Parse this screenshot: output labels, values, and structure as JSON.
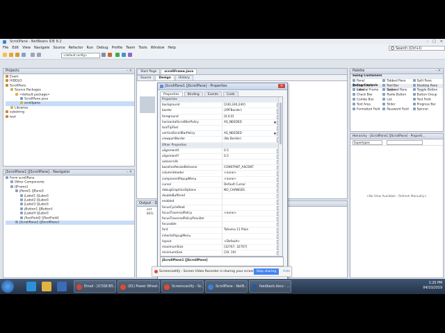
{
  "window": {
    "title": "ScrollPane - NetBeans IDE 8.2"
  },
  "menu": [
    "File",
    "Edit",
    "View",
    "Navigate",
    "Source",
    "Refactor",
    "Run",
    "Debug",
    "Profile",
    "Team",
    "Tools",
    "Window",
    "Help"
  ],
  "search": {
    "placeholder": "Search (Ctrl+I)"
  },
  "toolbar": {
    "config": "<default config>"
  },
  "projects": {
    "header": "Projects",
    "items": [
      {
        "label": "Exam",
        "indent": 0,
        "color": "#c98b2c"
      },
      {
        "label": "HIDDLO",
        "indent": 0,
        "color": "#c98b2c"
      },
      {
        "label": "ScrollPane",
        "indent": 0,
        "color": "#c98b2c"
      },
      {
        "label": "Source Packages",
        "indent": 1,
        "color": "#d8b14a"
      },
      {
        "label": "<default package>",
        "indent": 2,
        "color": "#d8b14a"
      },
      {
        "label": "ScrollPane.java",
        "indent": 3,
        "color": "#6e9bd1"
      },
      {
        "label": "scrollpane",
        "indent": 3,
        "color": "#d8b14a"
      },
      {
        "label": "Libraries",
        "indent": 1,
        "color": "#d8b14a"
      },
      {
        "label": "substring",
        "indent": 0,
        "color": "#c98b2c"
      },
      {
        "label": "test",
        "indent": 0,
        "color": "#c98b2c"
      }
    ]
  },
  "navigator": {
    "header": "jScrollPane1 [JScrollPane] - Navigator",
    "items": [
      {
        "label": "Form scrollPane",
        "indent": 0
      },
      {
        "label": "Other Components",
        "indent": 1
      },
      {
        "label": "[JFrame]",
        "indent": 1
      },
      {
        "label": "jPanel1 [JPanel]",
        "indent": 2
      },
      {
        "label": "jLabel1 [JLabel]",
        "indent": 3
      },
      {
        "label": "jLabel2 [JLabel]",
        "indent": 3
      },
      {
        "label": "jLabel3 [JLabel]",
        "indent": 3
      },
      {
        "label": "jButton1 [JButton]",
        "indent": 3
      },
      {
        "label": "jLabel4 [JLabel]",
        "indent": 3
      },
      {
        "label": "jTextField2 [JTextField]",
        "indent": 3
      },
      {
        "label": "jScrollPane1 [JScrollPane]",
        "indent": 2
      }
    ]
  },
  "editor": {
    "tabs": [
      "Start Page",
      "scrollFrame.java"
    ],
    "subtabs": [
      "Source",
      "Design",
      "History"
    ]
  },
  "output": {
    "header": "Output - Scro",
    "lines": [
      "ant",
      "BUIL"
    ]
  },
  "palette": {
    "header": "Palette",
    "groups": [
      {
        "title": "Swing Containers",
        "items": [
          "Panel",
          "Tabbed Pane",
          "Split Pane",
          "Scroll Pane",
          "Tool Bar",
          "Desktop Pane",
          "Internal Frame",
          "Layered Pane"
        ]
      },
      {
        "title": "Swing Controls",
        "items": [
          "Label",
          "Button",
          "Toggle Button",
          "Check Box",
          "Radio Button",
          "Button Group",
          "Combo Box",
          "List",
          "Text Field",
          "Text Area",
          "Slider",
          "Progress Bar",
          "Formatted Field",
          "Password Field",
          "Spinner"
        ]
      }
    ]
  },
  "hierarchy": {
    "header": "Hierarchy - jScrollPane1 [JScrollPane] - Properti...",
    "scope": "Supertypes",
    "empty": "<No View Available - Refresh Manually>"
  },
  "dialog": {
    "title": "jScrollPane1 [JScrollPane] - Properties",
    "tabs": [
      "Properties",
      "Binding",
      "Events",
      "Code"
    ],
    "rows": [
      {
        "name": "Properties",
        "value": "",
        "cat": true
      },
      {
        "name": "background",
        "value": "[240,240,240]"
      },
      {
        "name": "border",
        "value": "(XPFBorder)"
      },
      {
        "name": "foreground",
        "value": "[0,0,0]"
      },
      {
        "name": "horizontalScrollBarPolicy",
        "value": "AS_NEEDED",
        "dd": true
      },
      {
        "name": "toolTipText",
        "value": ""
      },
      {
        "name": "verticalScrollBarPolicy",
        "value": "AS_NEEDED",
        "dd": true
      },
      {
        "name": "viewportBorder",
        "value": "(No Border)"
      },
      {
        "name": "Other Properties",
        "value": "",
        "cat": true
      },
      {
        "name": "alignmentX",
        "value": "0.5"
      },
      {
        "name": "alignmentY",
        "value": "0.5"
      },
      {
        "name": "autoscrolls",
        "value": ""
      },
      {
        "name": "baselineResizeBehavior",
        "value": "CONSTANT_ASCENT"
      },
      {
        "name": "columnHeader",
        "value": "<none>"
      },
      {
        "name": "componentPopupMenu",
        "value": "<none>"
      },
      {
        "name": "cursor",
        "value": "Default Cursor"
      },
      {
        "name": "debugGraphicsOptions",
        "value": "NO_CHANGES"
      },
      {
        "name": "doubleBuffered",
        "value": ""
      },
      {
        "name": "enabled",
        "value": ""
      },
      {
        "name": "focusCycleRoot",
        "value": ""
      },
      {
        "name": "focusTraversalPolicy",
        "value": "<none>"
      },
      {
        "name": "focusTraversalPolicyProvider",
        "value": ""
      },
      {
        "name": "focusable",
        "value": ""
      },
      {
        "name": "font",
        "value": "Tahoma 11 Plain"
      },
      {
        "name": "inheritsPopupMenu",
        "value": ""
      },
      {
        "name": "layout",
        "value": "<Default>"
      },
      {
        "name": "maximumSize",
        "value": "[32767, 32767]"
      },
      {
        "name": "minimumSize",
        "value": "[19, 19]"
      },
      {
        "name": "name",
        "value": ""
      },
      {
        "name": "nextFocusableComponent",
        "value": "<none>"
      },
      {
        "name": "opaque",
        "value": ""
      }
    ],
    "description": "jScrollPane1 [JScrollPane]",
    "close": "Close",
    "help": "Help"
  },
  "share": {
    "message": "Screencastify - Screen Video Recorder is sharing your screen.",
    "stop": "Stop sharing",
    "hide": "Hide"
  },
  "taskbar": {
    "tasks": [
      {
        "label": "Email - [ICSSE-B5...",
        "color": "#d44638"
      },
      {
        "label": "(81) Power Wheel...",
        "color": "#e04a2f"
      },
      {
        "label": "Screencastify - Sc...",
        "color": "#e04a2f"
      },
      {
        "label": "ScrollPane - NetB...",
        "color": "#3d7fd6"
      },
      {
        "label": "feedback.docx - ...",
        "color": "#2b5797"
      }
    ],
    "time": "1:25 PM",
    "date": "04/10/2019"
  }
}
